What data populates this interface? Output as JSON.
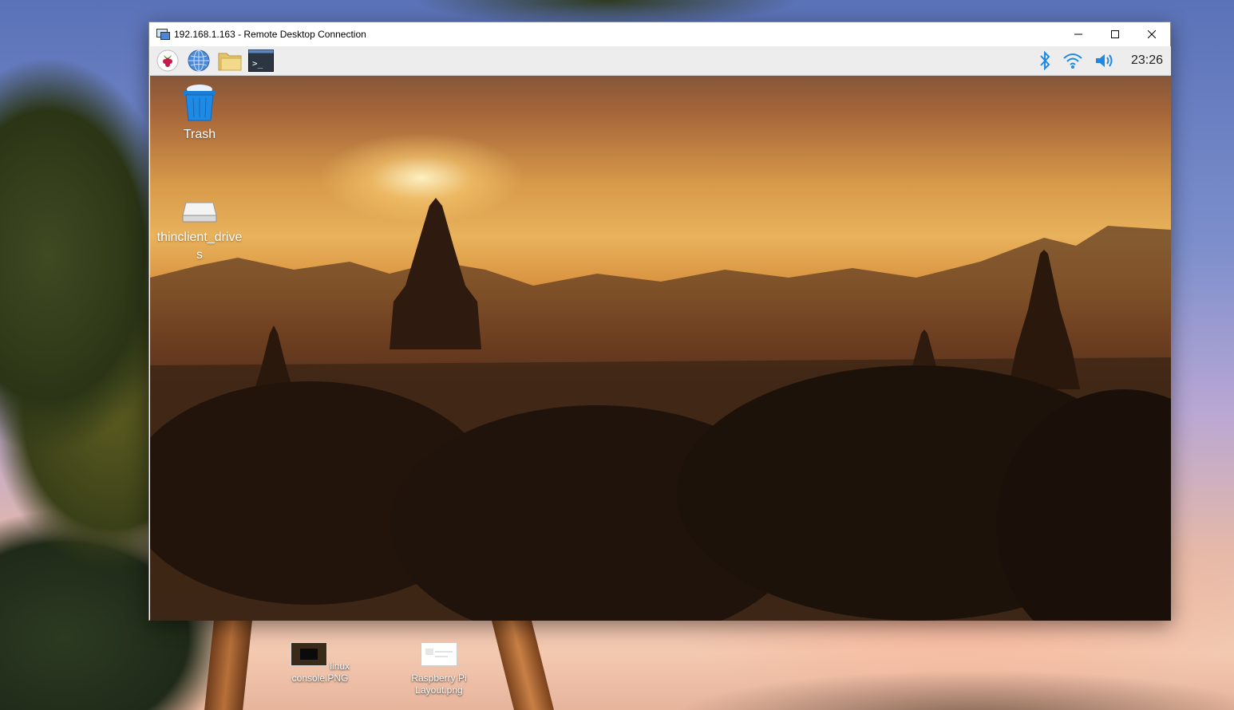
{
  "host_desktop": {
    "icons": [
      {
        "label": "linux\nconsole.PNG",
        "icon": "image-file-icon"
      },
      {
        "label": "Raspberry Pi\nLayout.png",
        "icon": "image-file-icon"
      }
    ]
  },
  "window": {
    "title": "192.168.1.163 - Remote Desktop Connection",
    "controls": [
      "minimize",
      "maximize",
      "close"
    ]
  },
  "taskbar": {
    "launchers": [
      "raspberry-menu-icon",
      "web-browser-icon",
      "file-manager-icon",
      "terminal-icon"
    ],
    "terminal_prompt": ">_",
    "tray": [
      "bluetooth-icon",
      "wifi-icon",
      "volume-icon"
    ],
    "clock": "23:26",
    "accent": "#1e88e5"
  },
  "pi_desktop": {
    "icons": [
      {
        "label": "Trash",
        "icon": "trash-icon"
      },
      {
        "label": "thinclient_drives",
        "icon": "drive-icon"
      }
    ]
  }
}
